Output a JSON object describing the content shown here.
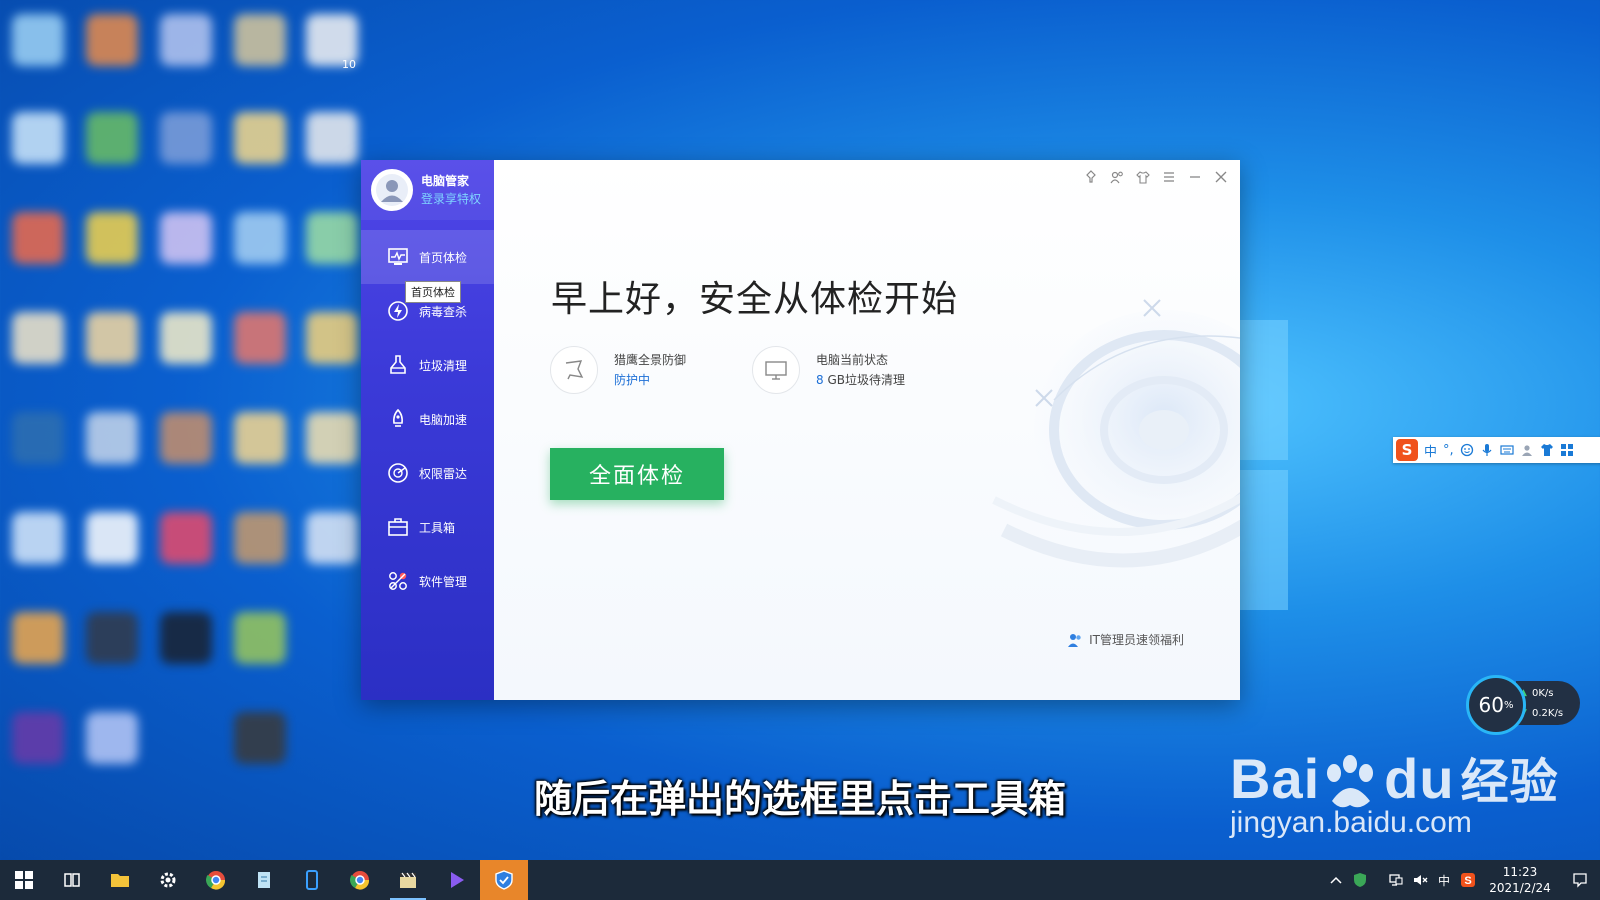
{
  "desktop": {
    "visible_numbers": [
      "10"
    ]
  },
  "app": {
    "profile": {
      "name": "电脑管家",
      "login_link": "登录享特权"
    },
    "nav": [
      {
        "label": "首页体检",
        "icon": "monitor-pulse-icon",
        "active": true
      },
      {
        "label": "病毒查杀",
        "icon": "lightning-shield-icon",
        "active": false
      },
      {
        "label": "垃圾清理",
        "icon": "broom-icon",
        "active": false
      },
      {
        "label": "电脑加速",
        "icon": "rocket-icon",
        "active": false
      },
      {
        "label": "权限雷达",
        "icon": "radar-icon",
        "active": false
      },
      {
        "label": "工具箱",
        "icon": "toolbox-icon",
        "active": false
      },
      {
        "label": "软件管理",
        "icon": "apps-icon",
        "active": false
      }
    ],
    "tooltip": "首页体检",
    "headline": "早上好，安全从体检开始",
    "protection": {
      "title": "猎鹰全景防御",
      "status": "防护中"
    },
    "pc_status": {
      "title": "电脑当前状态",
      "junk_amount": "8",
      "junk_suffix": " GB垃圾待清理"
    },
    "scan_button": "全面体检",
    "footer_link": "IT管理员速领福利",
    "titlebar_icons": [
      "pin-icon",
      "friends-icon",
      "skin-icon",
      "menu-icon",
      "minimize-icon",
      "close-icon"
    ]
  },
  "ime": {
    "logo": "S",
    "mode": "中",
    "punct": "°,"
  },
  "speed_widget": {
    "percent": "60",
    "percent_unit": "%",
    "upload": "0K/s",
    "download": "0.2K/s"
  },
  "subtitle": "随后在弹出的选框里点击工具箱",
  "watermark": {
    "brand_a": "Bai",
    "brand_b": "du",
    "brand_cn": "经验",
    "url": "jingyan.baidu.com"
  },
  "taskbar": {
    "clock_time": "11:23",
    "clock_date": "2021/2/24",
    "tray_lang": "中"
  }
}
